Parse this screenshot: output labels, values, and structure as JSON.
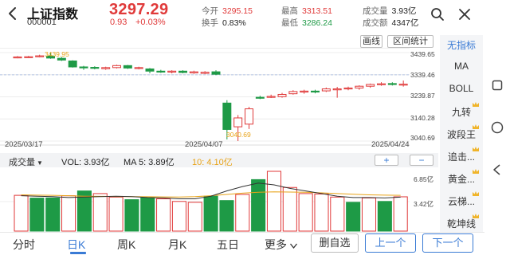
{
  "header": {
    "title": "上证指数",
    "code": "000001",
    "price": "3297.29",
    "change": "0.93",
    "change_pct": "+0.03%",
    "stats": [
      {
        "key": "今开",
        "value": "3295.15",
        "tone": "red"
      },
      {
        "key": "最高",
        "value": "3313.51",
        "tone": "red"
      },
      {
        "key": "成交量",
        "value": "3.93亿",
        "tone": "dark"
      },
      {
        "key": "换手",
        "value": "0.83%",
        "tone": "dark"
      },
      {
        "key": "最低",
        "value": "3286.24",
        "tone": "green"
      },
      {
        "key": "成交额",
        "value": "4347亿",
        "tone": "dark"
      }
    ]
  },
  "chart_toolbar": {
    "draw_line": "画线",
    "range_stats": "区间统计"
  },
  "chart": {
    "y_labels": [
      "3439.65",
      "3339.46",
      "3239.87",
      "3140.28",
      "3040.69"
    ],
    "high_annotation": "3439.95",
    "low_annotation": "3040.69",
    "dates": [
      "2025/03/17",
      "2025/04/07",
      "2025/04/24"
    ]
  },
  "volume_bar": {
    "selector": "成交量",
    "vol": "VOL: 3.93亿",
    "ma5": "MA 5: 3.89亿",
    "ma10": "10: 4.10亿",
    "y_labels": [
      "6.85亿",
      "3.42亿"
    ]
  },
  "indicators": [
    {
      "label": "无指标",
      "active": true,
      "premium": false
    },
    {
      "label": "MA",
      "active": false,
      "premium": false
    },
    {
      "label": "BOLL",
      "active": false,
      "premium": false
    },
    {
      "label": "九转",
      "active": false,
      "premium": true
    },
    {
      "label": "波段王",
      "active": false,
      "premium": true
    },
    {
      "label": "追击...",
      "active": false,
      "premium": true
    },
    {
      "label": "黄金...",
      "active": false,
      "premium": true
    },
    {
      "label": "云梯...",
      "active": false,
      "premium": true
    },
    {
      "label": "乾坤线",
      "active": false,
      "premium": true
    }
  ],
  "tabs": [
    "分时",
    "日K",
    "周K",
    "月K",
    "五日",
    "更多"
  ],
  "active_tab": "日K",
  "buttons": {
    "remove_watch": "删自选",
    "prev": "上一个",
    "next": "下一个"
  },
  "colors": {
    "up": "#e03a3a",
    "down": "#1e9a46",
    "accent": "#3a7bd5",
    "ma10": "#e8a317"
  },
  "chart_data": {
    "type": "candlestick",
    "date_range": [
      "2025/03/17",
      "2025/04/24"
    ],
    "ylim": [
      3040.69,
      3439.65
    ],
    "candles": [
      {
        "o": 3417,
        "c": 3420,
        "h": 3424,
        "l": 3414
      },
      {
        "o": 3418,
        "c": 3421,
        "h": 3425,
        "l": 3415
      },
      {
        "o": 3421,
        "c": 3425,
        "h": 3430,
        "l": 3418
      },
      {
        "o": 3424,
        "c": 3415,
        "h": 3439.95,
        "l": 3412
      },
      {
        "o": 3414,
        "c": 3406,
        "h": 3420,
        "l": 3402
      },
      {
        "o": 3402,
        "c": 3375,
        "h": 3405,
        "l": 3372
      },
      {
        "o": 3375,
        "c": 3372,
        "h": 3380,
        "l": 3362
      },
      {
        "o": 3373,
        "c": 3369,
        "h": 3378,
        "l": 3364
      },
      {
        "o": 3367,
        "c": 3372,
        "h": 3376,
        "l": 3362
      },
      {
        "o": 3372,
        "c": 3381,
        "h": 3385,
        "l": 3368
      },
      {
        "o": 3381,
        "c": 3370,
        "h": 3384,
        "l": 3366
      },
      {
        "o": 3368,
        "c": 3372,
        "h": 3376,
        "l": 3364
      },
      {
        "o": 3366,
        "c": 3356,
        "h": 3370,
        "l": 3346
      },
      {
        "o": 3356,
        "c": 3352,
        "h": 3362,
        "l": 3348
      },
      {
        "o": 3352,
        "c": 3356,
        "h": 3360,
        "l": 3346
      },
      {
        "o": 3356,
        "c": 3350,
        "h": 3360,
        "l": 3346
      },
      {
        "o": 3348,
        "c": 3353,
        "h": 3358,
        "l": 3344
      },
      {
        "o": 3346,
        "c": 3351,
        "h": 3356,
        "l": 3342
      },
      {
        "o": 3353,
        "c": 3342,
        "h": 3360,
        "l": 3338
      },
      {
        "o": 3212,
        "c": 3093,
        "h": 3225,
        "l": 3048
      },
      {
        "o": 3105,
        "c": 3145,
        "h": 3158,
        "l": 3040.69
      },
      {
        "o": 3117,
        "c": 3186,
        "h": 3195,
        "l": 3095
      },
      {
        "o": 3238,
        "c": 3236,
        "h": 3245,
        "l": 3230
      },
      {
        "o": 3238,
        "c": 3242,
        "h": 3250,
        "l": 3235
      },
      {
        "o": 3241,
        "c": 3251,
        "h": 3258,
        "l": 3236
      },
      {
        "o": 3254,
        "c": 3264,
        "h": 3270,
        "l": 3250
      },
      {
        "o": 3262,
        "c": 3266,
        "h": 3272,
        "l": 3254
      },
      {
        "o": 3266,
        "c": 3265,
        "h": 3272,
        "l": 3256
      },
      {
        "o": 3267,
        "c": 3276,
        "h": 3282,
        "l": 3262
      },
      {
        "o": 3276,
        "c": 3276,
        "h": 3285,
        "l": 3236
      },
      {
        "o": 3276,
        "c": 3280,
        "h": 3286,
        "l": 3270
      },
      {
        "o": 3280,
        "c": 3288,
        "h": 3292,
        "l": 3272
      },
      {
        "o": 3288,
        "c": 3296,
        "h": 3300,
        "l": 3281
      },
      {
        "o": 3296,
        "c": 3299,
        "h": 3306,
        "l": 3290
      },
      {
        "o": 3300,
        "c": 3296,
        "h": 3306,
        "l": 3291
      },
      {
        "o": 3295,
        "c": 3297.29,
        "h": 3313.51,
        "l": 3286.24
      }
    ],
    "volume": {
      "unit": "亿",
      "ylim": [
        0,
        6.85
      ],
      "bars": [
        {
          "v": 4.1,
          "up": true
        },
        {
          "v": 3.78,
          "up": false
        },
        {
          "v": 3.8,
          "up": false
        },
        {
          "v": 4.05,
          "up": true
        },
        {
          "v": 4.6,
          "up": false
        },
        {
          "v": 4.3,
          "up": true
        },
        {
          "v": 3.9,
          "up": true
        },
        {
          "v": 3.6,
          "up": false
        },
        {
          "v": 3.8,
          "up": false
        },
        {
          "v": 3.7,
          "up": true
        },
        {
          "v": 3.4,
          "up": true
        },
        {
          "v": 3.3,
          "up": true
        },
        {
          "v": 4.0,
          "up": false
        },
        {
          "v": 3.5,
          "up": false
        },
        {
          "v": 4.2,
          "up": true
        },
        {
          "v": 5.9,
          "up": false
        },
        {
          "v": 6.85,
          "up": true
        },
        {
          "v": 5.0,
          "up": true
        },
        {
          "v": 4.3,
          "up": true
        },
        {
          "v": 4.25,
          "up": true
        },
        {
          "v": 3.9,
          "up": true
        },
        {
          "v": 3.3,
          "up": false
        },
        {
          "v": 3.8,
          "up": true
        },
        {
          "v": 3.4,
          "up": false
        },
        {
          "v": 3.93,
          "up": true
        }
      ],
      "ma5": [
        4.05,
        4.0,
        3.95,
        3.85,
        3.9,
        3.95,
        4.0,
        3.95,
        3.85,
        3.8,
        3.7,
        3.7,
        4.0,
        4.6,
        5.1,
        5.5,
        5.3,
        4.9,
        4.6,
        4.3,
        4.0,
        3.85,
        3.85,
        3.8,
        3.89
      ],
      "ma10": [
        4.15,
        4.12,
        4.1,
        4.05,
        4.0,
        3.98,
        3.96,
        3.95,
        3.94,
        3.92,
        3.9,
        3.95,
        4.05,
        4.2,
        4.35,
        4.45,
        4.5,
        4.48,
        4.45,
        4.38,
        4.3,
        4.22,
        4.15,
        4.12,
        4.1
      ]
    }
  }
}
